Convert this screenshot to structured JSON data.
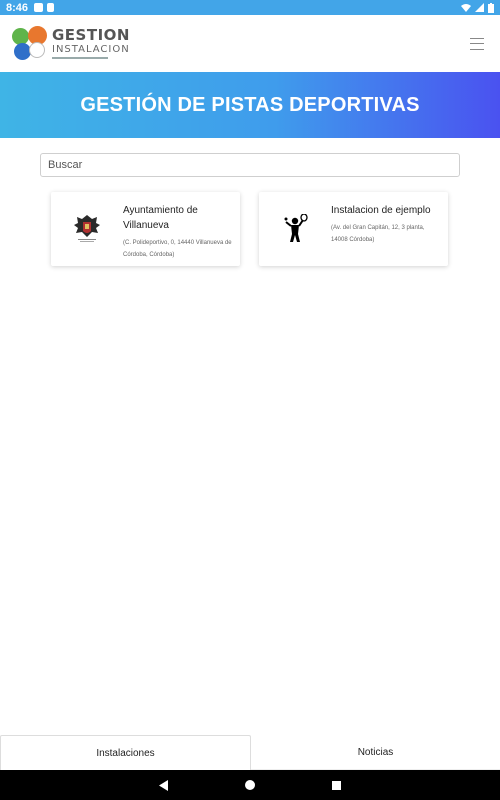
{
  "status_bar": {
    "time": "8:46"
  },
  "header": {
    "logo_line1": "GESTION",
    "logo_line2": "INSTALACION"
  },
  "banner": {
    "title": "GESTIÓN DE PISTAS DEPORTIVAS"
  },
  "search": {
    "placeholder": "Buscar"
  },
  "cards": [
    {
      "name": "Ayuntamiento de Villanueva",
      "address": "(C. Polideportivo, 0, 14440 Villanueva de Córdoba, Córdoba)",
      "icon": "coat-of-arms-icon"
    },
    {
      "name": "Instalacion de ejemplo",
      "address": "(Av. del Gran Capitán, 12, 3 planta, 14008 Córdoba)",
      "icon": "tennis-player-icon"
    }
  ],
  "bottom_tabs": [
    {
      "label": "Instalaciones",
      "active": true
    },
    {
      "label": "Noticias",
      "active": false
    }
  ],
  "colors": {
    "status_bar": "#42a5e8",
    "banner_start": "#3fb4e6",
    "banner_end": "#4a52f0"
  }
}
